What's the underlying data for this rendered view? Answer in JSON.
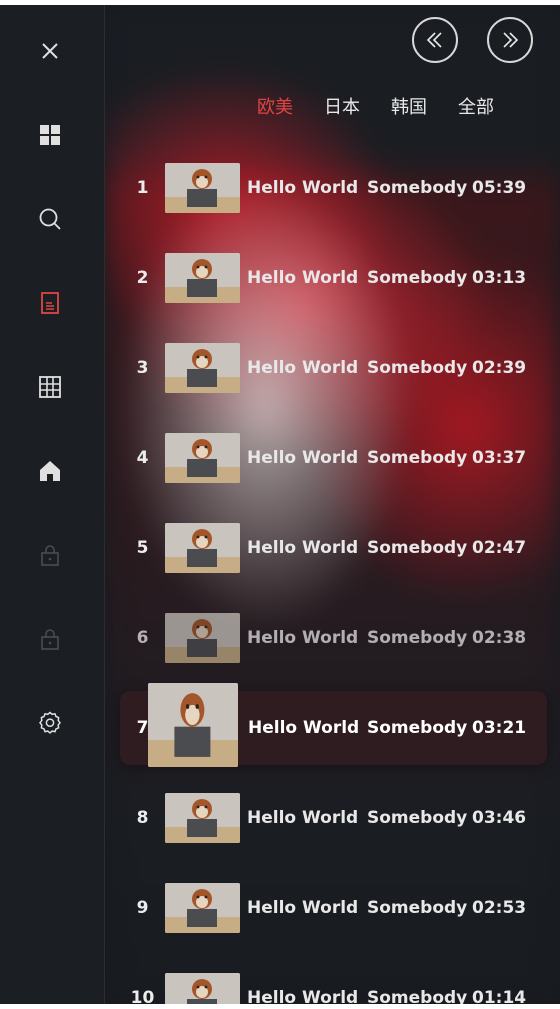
{
  "sidebar": {
    "items": [
      {
        "name": "close-icon"
      },
      {
        "name": "grid-icon"
      },
      {
        "name": "search-icon"
      },
      {
        "name": "document-icon"
      },
      {
        "name": "table-icon"
      },
      {
        "name": "home-icon"
      },
      {
        "name": "lock-icon"
      },
      {
        "name": "lock-icon"
      },
      {
        "name": "settings-icon"
      }
    ],
    "active_color": "#e04545"
  },
  "nav": {
    "prev": "chevrons-left-icon",
    "next": "chevrons-right-icon"
  },
  "tabs": [
    {
      "label": "欧美",
      "active": true
    },
    {
      "label": "日本",
      "active": false
    },
    {
      "label": "韩国",
      "active": false
    },
    {
      "label": "全部",
      "active": false
    }
  ],
  "songs": [
    {
      "num": "1",
      "title": "Hello World",
      "artist": "Somebody",
      "duration": "05:39"
    },
    {
      "num": "2",
      "title": "Hello World",
      "artist": "Somebody",
      "duration": "03:13"
    },
    {
      "num": "3",
      "title": "Hello World",
      "artist": "Somebody",
      "duration": "02:39"
    },
    {
      "num": "4",
      "title": "Hello World",
      "artist": "Somebody",
      "duration": "03:37"
    },
    {
      "num": "5",
      "title": "Hello World",
      "artist": "Somebody",
      "duration": "02:47"
    },
    {
      "num": "6",
      "title": "Hello World",
      "artist": "Somebody",
      "duration": "02:38"
    },
    {
      "num": "7",
      "title": "Hello World",
      "artist": "Somebody",
      "duration": "03:21"
    },
    {
      "num": "8",
      "title": "Hello World",
      "artist": "Somebody",
      "duration": "03:46"
    },
    {
      "num": "9",
      "title": "Hello World",
      "artist": "Somebody",
      "duration": "02:53"
    },
    {
      "num": "10",
      "title": "Hello World",
      "artist": "Somebody",
      "duration": "01:14"
    }
  ],
  "active_song_index": 6
}
